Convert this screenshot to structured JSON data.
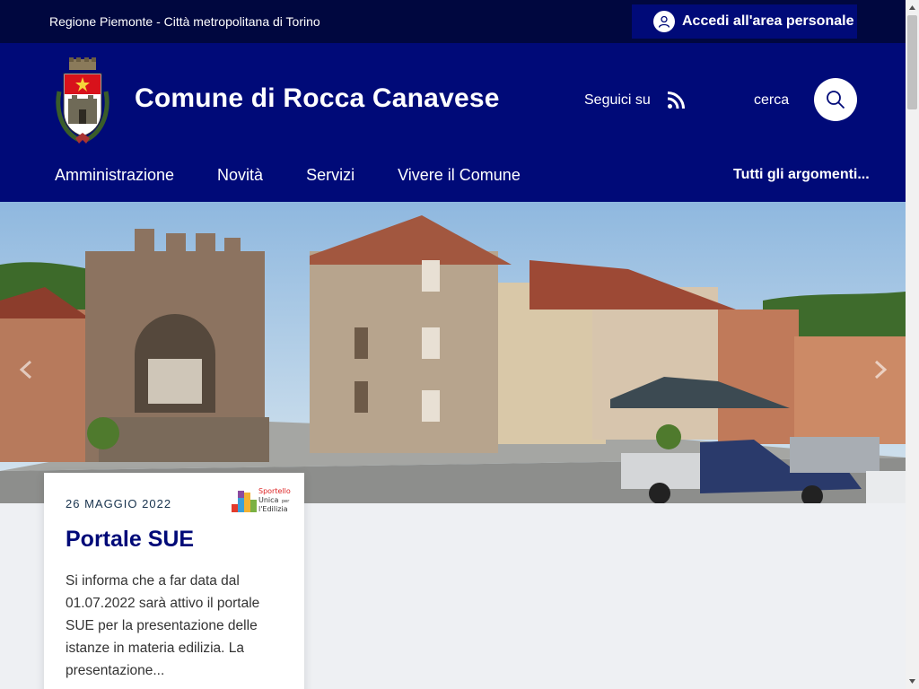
{
  "slimbar": {
    "region": "Regione Piemonte - Città metropolitana di Torino",
    "login_label": "Accedi all'area personale"
  },
  "header": {
    "title": "Comune di Rocca Canavese",
    "social_label": "Seguici su",
    "search_label": "cerca",
    "nav": [
      "Amministrazione",
      "Novità",
      "Servizi",
      "Vivere il Comune"
    ],
    "topics_label": "Tutti gli argomenti..."
  },
  "card": {
    "date": "26 MAGGIO 2022",
    "title": "Portale SUE",
    "text": "Si informa che a far data dal 01.07.2022 sarà attivo il portale SUE per la presentazione delle istanze in materia edilizia. La presentazione...",
    "logo": {
      "line1": "Sportello",
      "line2": "Unica",
      "line2b": "per",
      "line3": "l'Edilizia"
    }
  },
  "icons": {
    "user": "user-icon",
    "rss": "rss-icon",
    "search": "search-icon",
    "prev": "chevron-left-icon",
    "next": "chevron-right-icon"
  },
  "colors": {
    "primary": "#000a78",
    "slimbar": "#00073f",
    "background": "#eef0f3"
  }
}
